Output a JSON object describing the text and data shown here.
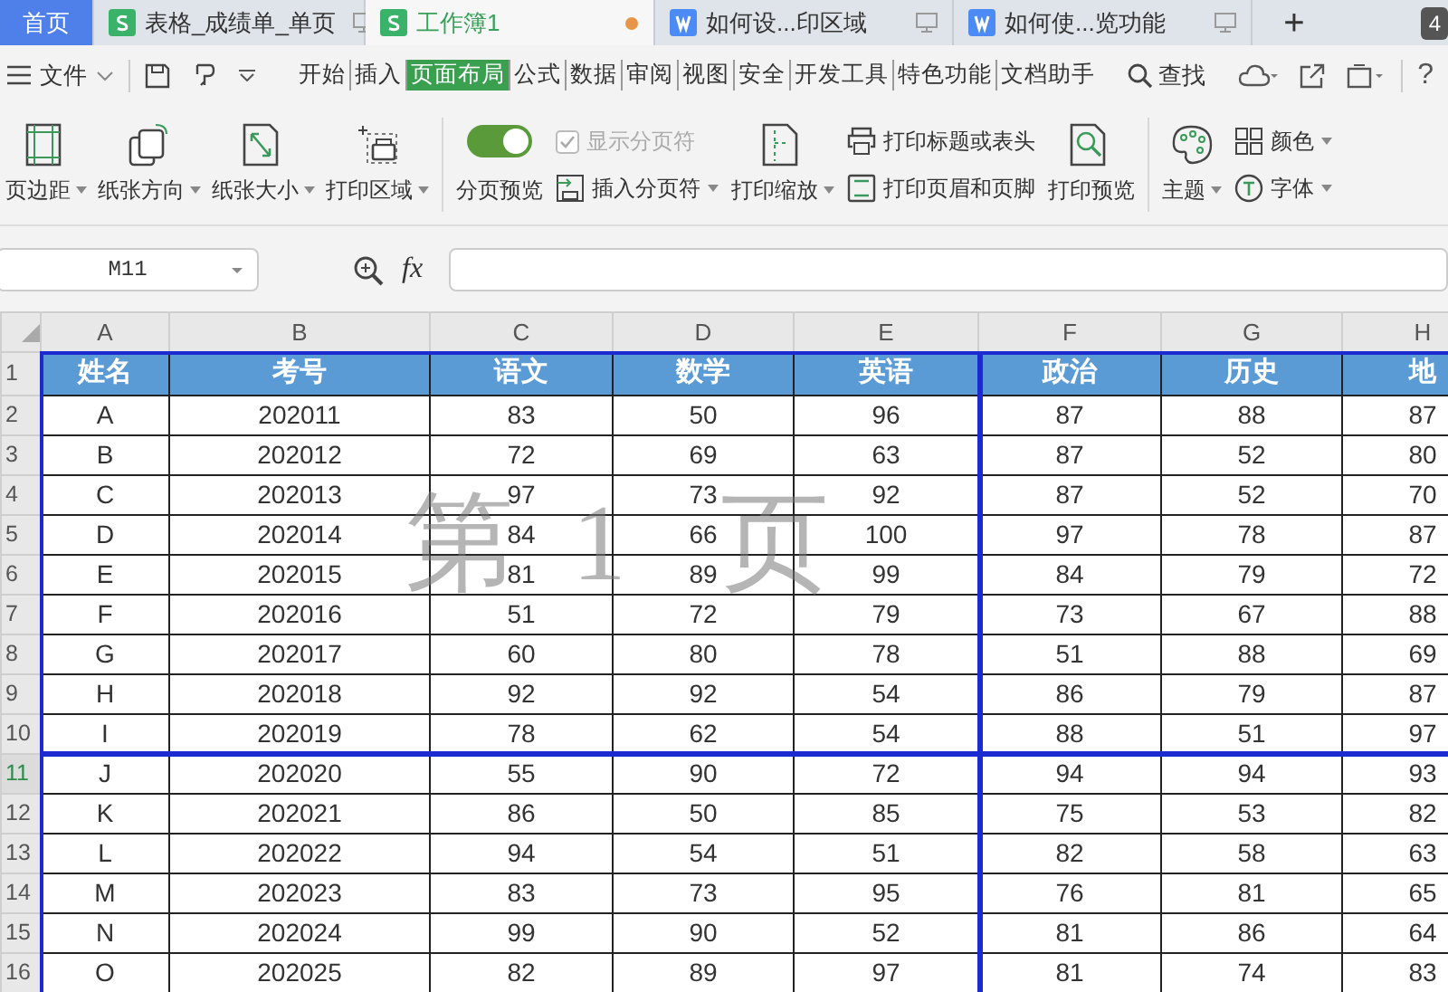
{
  "tabs": [
    {
      "kind": "home",
      "label": "首页",
      "selected": false
    },
    {
      "kind": "sheet",
      "label": "表格_成绩单_单页",
      "selected": false,
      "modified": false
    },
    {
      "kind": "sheet",
      "label": "工作簿1",
      "selected": true,
      "modified": true
    },
    {
      "kind": "doc",
      "label": "如何设...印区域",
      "selected": false,
      "modified": false
    },
    {
      "kind": "doc",
      "label": "如何使...览功能",
      "selected": false,
      "modified": false
    }
  ],
  "new_tab": "+",
  "tab_count": "4",
  "menu": {
    "file": "文件",
    "ribbon_tabs": [
      {
        "label": "开始",
        "selected": false
      },
      {
        "label": "插入",
        "selected": false
      },
      {
        "label": "页面布局",
        "selected": true
      },
      {
        "label": "公式",
        "selected": false
      },
      {
        "label": "数据",
        "selected": false
      },
      {
        "label": "审阅",
        "selected": false
      },
      {
        "label": "视图",
        "selected": false
      },
      {
        "label": "安全",
        "selected": false
      },
      {
        "label": "开发工具",
        "selected": false
      },
      {
        "label": "特色功能",
        "selected": false
      },
      {
        "label": "文档助手",
        "selected": false
      }
    ],
    "search": "查找",
    "help": "?"
  },
  "ribbon": [
    {
      "kind": "big",
      "label": "页边距",
      "dropdown": true
    },
    {
      "kind": "big",
      "label": "纸张方向",
      "dropdown": true
    },
    {
      "kind": "big",
      "label": "纸张大小",
      "dropdown": true
    },
    {
      "kind": "big",
      "label": "打印区域",
      "dropdown": true
    },
    {
      "kind": "separator"
    },
    {
      "kind": "toggle",
      "label": "分页预览",
      "on": true
    },
    {
      "kind": "stack",
      "items": [
        {
          "kind": "checkbox",
          "label": "显示分页符",
          "checked": true,
          "disabled": true
        },
        {
          "kind": "small",
          "label": "插入分页符",
          "dropdown": true
        }
      ]
    },
    {
      "kind": "big",
      "label": "打印缩放",
      "dropdown": true
    },
    {
      "kind": "stack",
      "items": [
        {
          "kind": "small",
          "label": "打印标题或表头",
          "dropdown": false
        },
        {
          "kind": "small",
          "label": "打印页眉和页脚",
          "dropdown": false
        }
      ]
    },
    {
      "kind": "big",
      "label": "打印预览",
      "dropdown": false
    },
    {
      "kind": "separator"
    },
    {
      "kind": "big",
      "label": "主题",
      "dropdown": true
    },
    {
      "kind": "stack",
      "items": [
        {
          "kind": "small",
          "label": "颜色",
          "dropdown": true
        },
        {
          "kind": "small",
          "label": "字体",
          "dropdown": true
        }
      ]
    }
  ],
  "formula_bar": {
    "cell_ref": "M11",
    "fx": "fx"
  },
  "sheet": {
    "columns": [
      "A",
      "B",
      "C",
      "D",
      "E",
      "F",
      "G",
      "H"
    ],
    "header": [
      "姓名",
      "考号",
      "语文",
      "数学",
      "英语",
      "政治",
      "历史",
      "地"
    ],
    "rows": [
      {
        "number": "2",
        "selected": false,
        "cells": [
          "A",
          "202011",
          "83",
          "50",
          "96",
          "87",
          "88",
          "87"
        ]
      },
      {
        "number": "3",
        "selected": false,
        "cells": [
          "B",
          "202012",
          "72",
          "69",
          "63",
          "87",
          "52",
          "80"
        ]
      },
      {
        "number": "4",
        "selected": false,
        "cells": [
          "C",
          "202013",
          "97",
          "73",
          "92",
          "87",
          "52",
          "70"
        ]
      },
      {
        "number": "5",
        "selected": false,
        "cells": [
          "D",
          "202014",
          "84",
          "66",
          "100",
          "97",
          "78",
          "87"
        ]
      },
      {
        "number": "6",
        "selected": false,
        "cells": [
          "E",
          "202015",
          "81",
          "89",
          "99",
          "84",
          "79",
          "72"
        ]
      },
      {
        "number": "7",
        "selected": false,
        "cells": [
          "F",
          "202016",
          "51",
          "72",
          "79",
          "73",
          "67",
          "88"
        ]
      },
      {
        "number": "8",
        "selected": false,
        "cells": [
          "G",
          "202017",
          "60",
          "80",
          "78",
          "51",
          "88",
          "69"
        ]
      },
      {
        "number": "9",
        "selected": false,
        "cells": [
          "H",
          "202018",
          "92",
          "92",
          "54",
          "86",
          "79",
          "87"
        ]
      },
      {
        "number": "10",
        "selected": false,
        "cells": [
          "I",
          "202019",
          "78",
          "62",
          "54",
          "88",
          "51",
          "97"
        ]
      },
      {
        "number": "11",
        "selected": true,
        "cells": [
          "J",
          "202020",
          "55",
          "90",
          "72",
          "94",
          "94",
          "93"
        ]
      },
      {
        "number": "12",
        "selected": false,
        "cells": [
          "K",
          "202021",
          "86",
          "50",
          "85",
          "75",
          "53",
          "82"
        ]
      },
      {
        "number": "13",
        "selected": false,
        "cells": [
          "L",
          "202022",
          "94",
          "54",
          "51",
          "82",
          "58",
          "63"
        ]
      },
      {
        "number": "14",
        "selected": false,
        "cells": [
          "M",
          "202023",
          "83",
          "73",
          "95",
          "76",
          "81",
          "65"
        ]
      },
      {
        "number": "15",
        "selected": false,
        "cells": [
          "N",
          "202024",
          "99",
          "90",
          "52",
          "81",
          "86",
          "64"
        ]
      },
      {
        "number": "16",
        "selected": false,
        "cells": [
          "O",
          "202025",
          "82",
          "89",
          "97",
          "81",
          "74",
          "83"
        ]
      }
    ],
    "header_row_number": "1",
    "page_label": [
      "第",
      "1",
      "页"
    ]
  }
}
